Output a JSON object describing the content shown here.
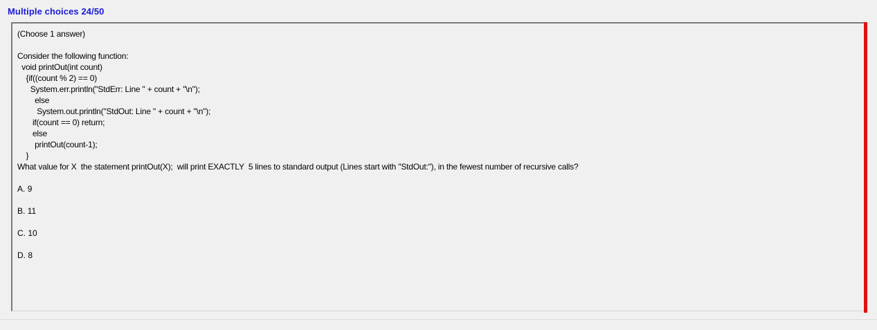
{
  "header": {
    "title": "Multiple choices 24/50"
  },
  "question": {
    "instruction": "(Choose 1 answer)",
    "lines": [
      "Consider the following function:",
      "  void printOut(int count)",
      "    {if((count % 2) == 0)",
      "      System.err.println(\"StdErr: Line \" + count + \"\\n\");",
      "        else",
      "         System.out.println(\"StdOut: Line \" + count + \"\\n\");",
      "       if(count == 0) return;",
      "       else",
      "        printOut(count-1);",
      "    }",
      "What value for X  the statement printOut(X);  will print EXACTLY  5 lines to standard output (Lines start with \"StdOut:\"), in the fewest number of recursive calls?"
    ]
  },
  "answers": [
    {
      "letter": "A.",
      "value": "9"
    },
    {
      "letter": "B.",
      "value": "11"
    },
    {
      "letter": "C.",
      "value": "10"
    },
    {
      "letter": "D.",
      "value": "8"
    }
  ],
  "colors": {
    "title": "#1a1ad6",
    "scroll_indicator": "#e01010",
    "background": "#f0f0f0"
  }
}
